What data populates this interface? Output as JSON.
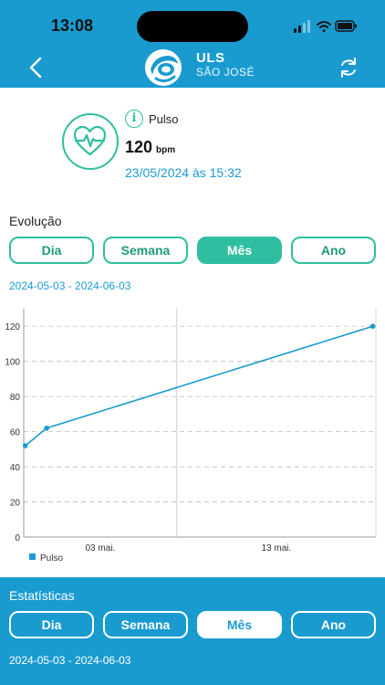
{
  "status_bar": {
    "time": "13:08"
  },
  "header": {
    "brand_title": "ULS",
    "brand_subtitle": "SÃO JOSÉ",
    "back_icon": "chevron-left-icon",
    "refresh_icon": "refresh-icon"
  },
  "measurement": {
    "name": "Pulso",
    "value": "120",
    "unit": "bpm",
    "datetime": "23/05/2024 às 15:32",
    "icon": "heart-pulse-icon"
  },
  "evolution": {
    "title": "Evolução",
    "tabs": [
      {
        "label": "Dia",
        "active": false
      },
      {
        "label": "Semana",
        "active": false
      },
      {
        "label": "Mês",
        "active": true
      },
      {
        "label": "Ano",
        "active": false
      }
    ],
    "date_range": "2024-05-03 - 2024-06-03"
  },
  "chart_data": {
    "type": "line",
    "x_ticks": [
      {
        "label": "03 mai.",
        "day": 3
      },
      {
        "label": "13 mai.",
        "day": 13
      }
    ],
    "series": [
      {
        "name": "Pulso",
        "color": "#1a9bd0",
        "points": [
          {
            "day": 0.1,
            "y": 52
          },
          {
            "day": 1.5,
            "y": 62
          },
          {
            "day": 22.8,
            "y": 120
          }
        ]
      }
    ],
    "ylim": [
      0,
      130
    ],
    "y_ticks": [
      0,
      20,
      40,
      60,
      80,
      100,
      120
    ],
    "xlim": [
      0,
      23
    ],
    "grid": true,
    "legend": "bottom-left"
  },
  "statistics": {
    "title": "Estatísticas",
    "tabs": [
      {
        "label": "Dia",
        "active": false
      },
      {
        "label": "Semana",
        "active": false
      },
      {
        "label": "Mês",
        "active": true
      },
      {
        "label": "Ano",
        "active": false
      }
    ],
    "date_range": "2024-05-03 - 2024-06-03"
  }
}
